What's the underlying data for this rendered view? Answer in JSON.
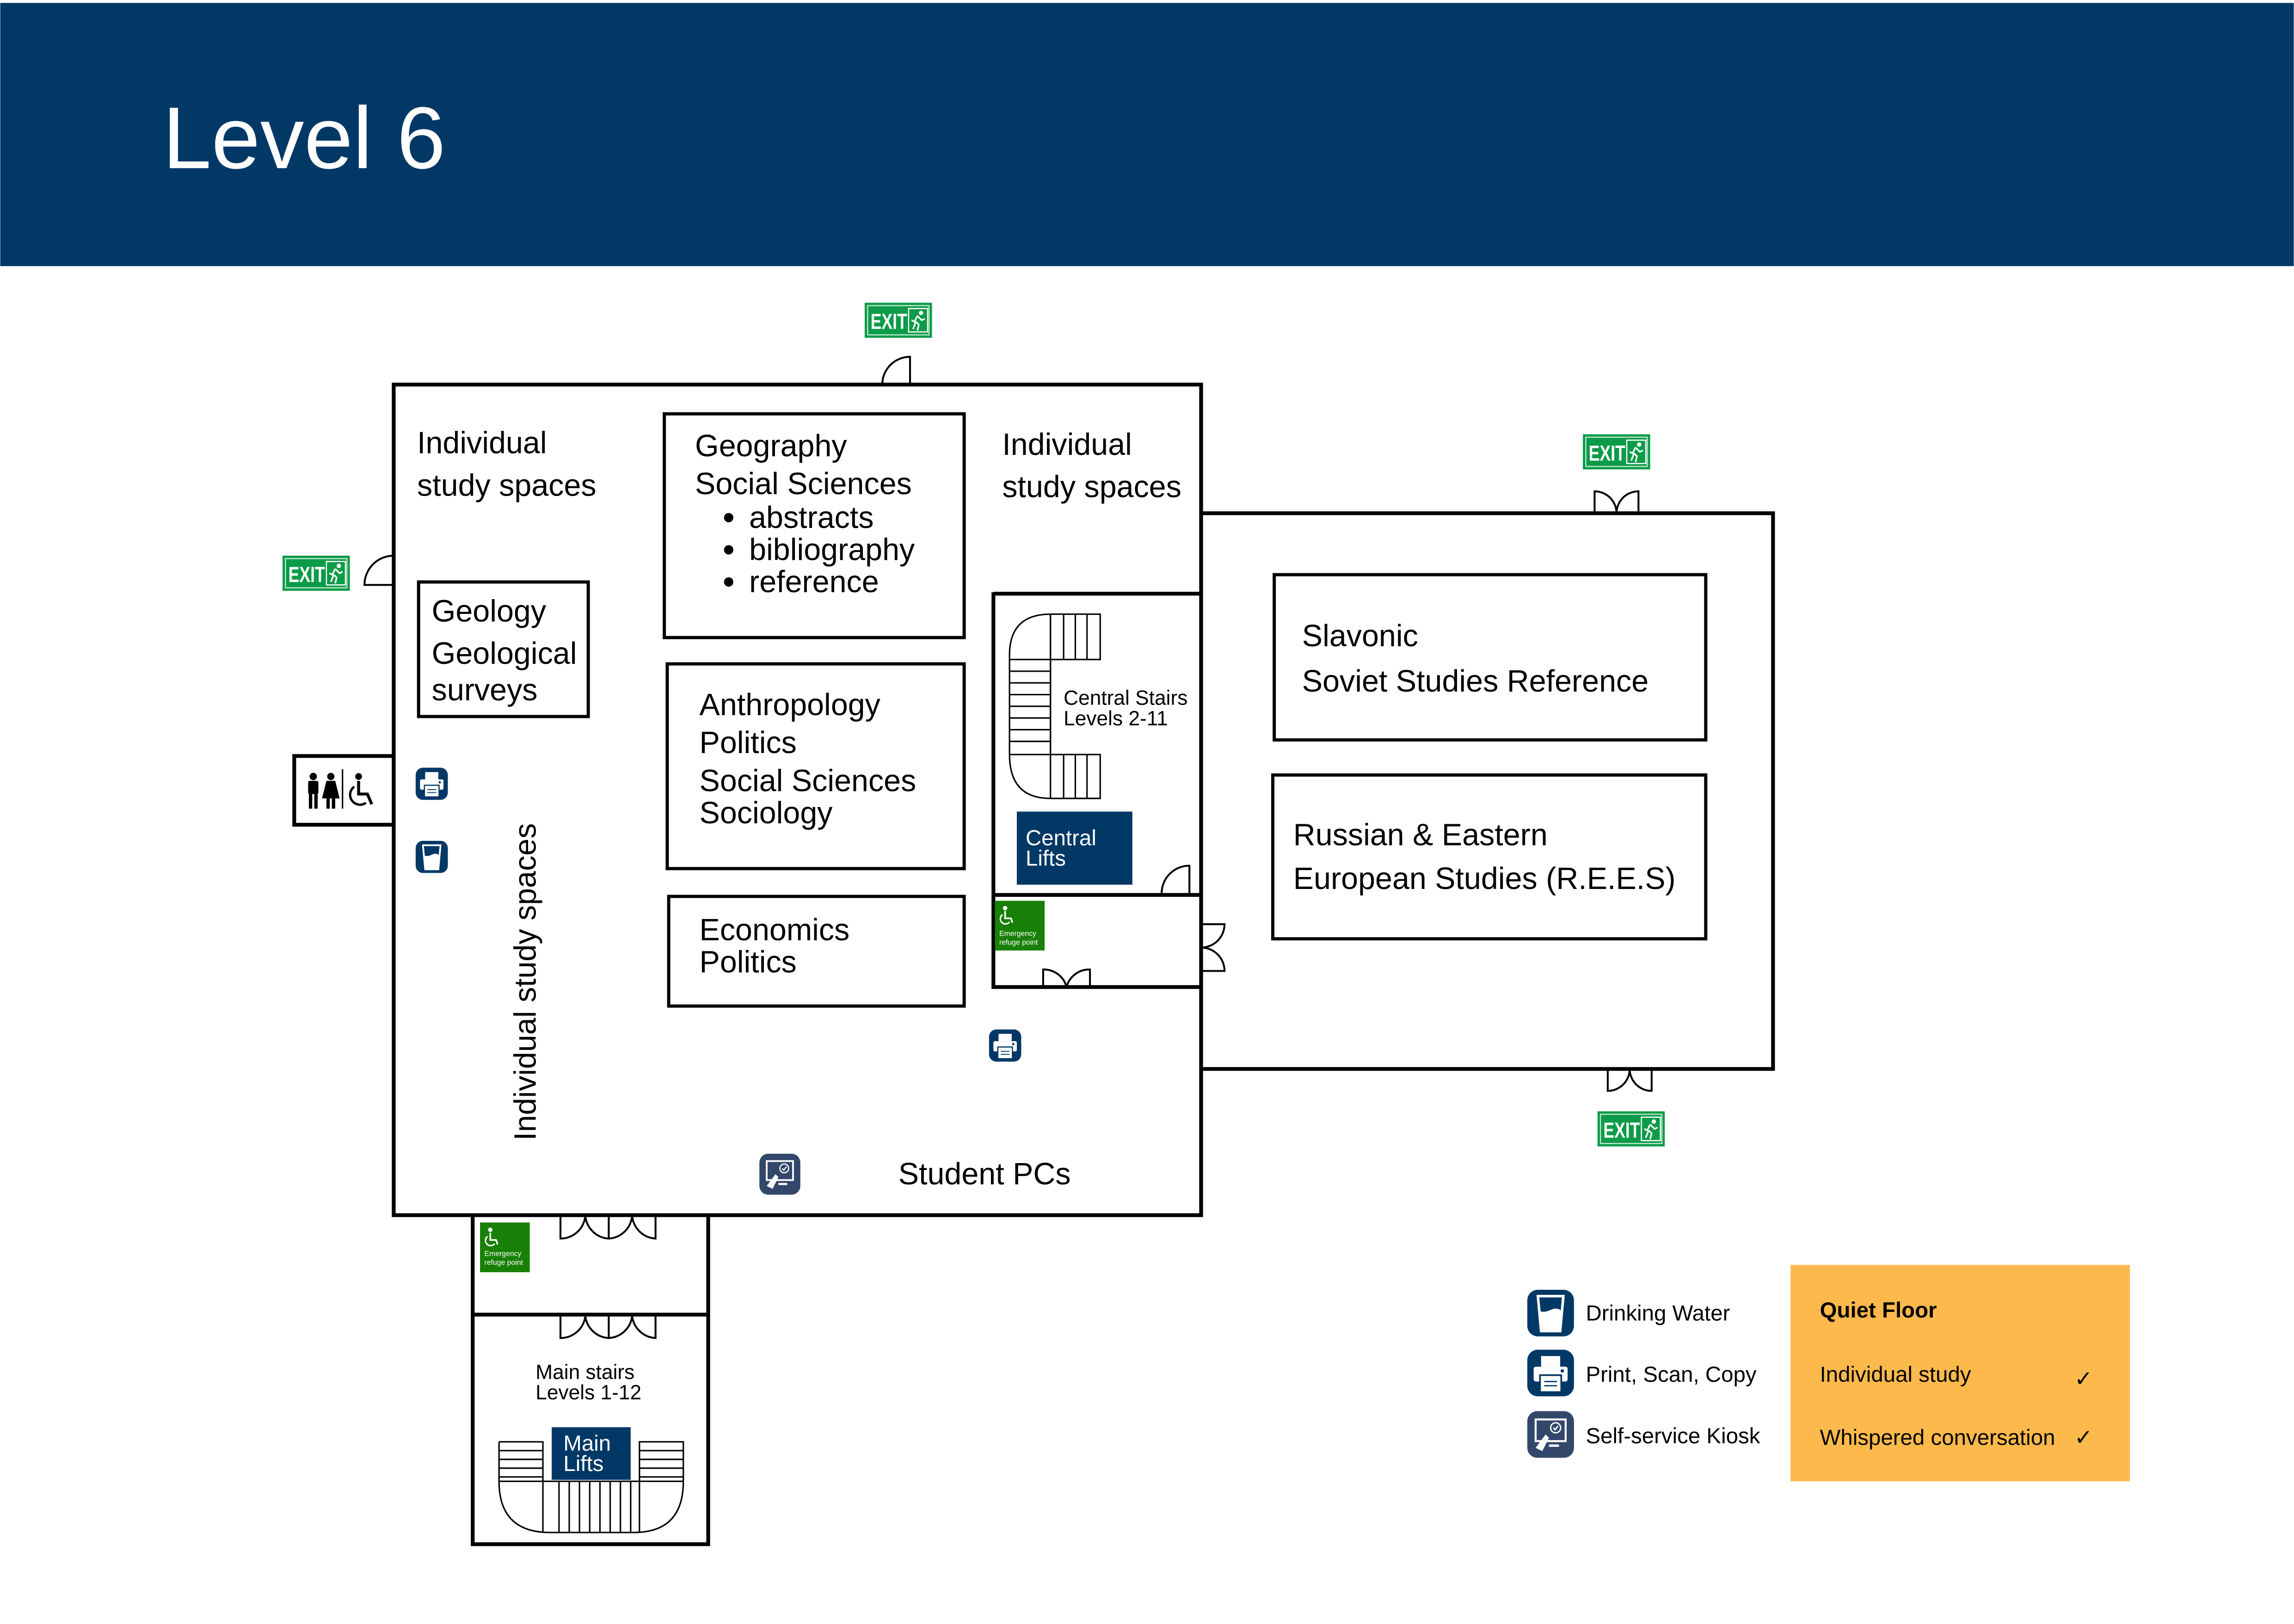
{
  "header": {
    "title": "Level 6",
    "background_color": "#023866",
    "text_color": "#ffffff"
  },
  "colors": {
    "brand_navy": "#023866",
    "exit_green": "#0c9b48",
    "refuge_green": "#188007",
    "quiet_orange": "#fdb94b",
    "kiosk_slate": "#33476b"
  },
  "exit_signs": [
    {
      "id": "top",
      "label": "EXIT",
      "icon": "running-man-icon"
    },
    {
      "id": "left",
      "label": "EXIT",
      "icon": "running-man-icon"
    },
    {
      "id": "right-top",
      "label": "EXIT",
      "icon": "running-man-icon"
    },
    {
      "id": "right-bottom",
      "label": "EXIT",
      "icon": "running-man-icon"
    }
  ],
  "areas": {
    "study_top_left": [
      "Individual",
      "study spaces"
    ],
    "study_top_right": [
      "Individual",
      "study spaces"
    ],
    "study_vertical": "Individual study spaces",
    "geology": [
      "Geology",
      "Geological",
      "surveys"
    ],
    "geography": {
      "lines": [
        "Geography",
        "Social Sciences"
      ],
      "bullets": [
        "abstracts",
        "bibliography",
        "reference"
      ]
    },
    "anthropology": [
      "Anthropology",
      "Politics",
      "Social Sciences",
      "Sociology"
    ],
    "economics": [
      "Economics",
      "Politics"
    ],
    "slavonic": [
      "Slavonic",
      "Soviet Studies Reference"
    ],
    "rees": [
      "Russian & Eastern",
      "European Studies (R.E.E.S)"
    ],
    "student_pcs": "Student PCs",
    "central_stairs": [
      "Central Stairs",
      "Levels 2-11"
    ],
    "central_lifts": [
      "Central",
      "Lifts"
    ],
    "main_stairs": [
      "Main stairs",
      "Levels 1-12"
    ],
    "main_lifts": [
      "Main",
      "Lifts"
    ],
    "refuge_point": [
      "Emergency",
      "refuge point"
    ],
    "toilets": {
      "icons": [
        "male-icon",
        "female-icon",
        "accessible-icon"
      ]
    }
  },
  "legend": {
    "items": [
      {
        "icon": "drinking-water-icon",
        "label": "Drinking Water"
      },
      {
        "icon": "printer-icon",
        "label": "Print, Scan, Copy"
      },
      {
        "icon": "kiosk-icon",
        "label": "Self-service Kiosk"
      }
    ]
  },
  "quiet_floor": {
    "title": "Quiet Floor",
    "rows": [
      {
        "label": "Individual study",
        "allowed": true,
        "mark": "✓"
      },
      {
        "label": "Whispered conversation",
        "allowed": true,
        "mark": "✓"
      }
    ]
  }
}
